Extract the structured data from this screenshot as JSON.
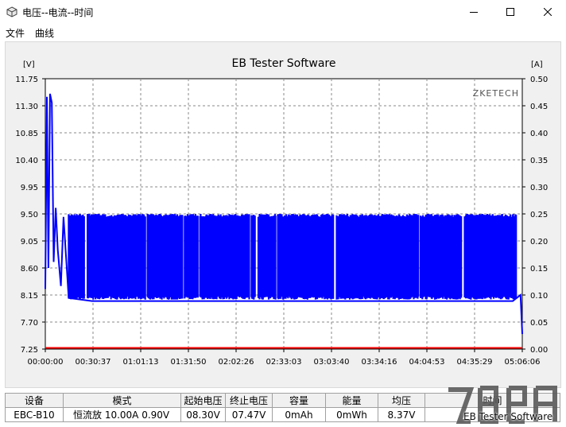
{
  "window": {
    "title": "电压--电流--时间"
  },
  "menu": [
    "文件",
    "曲线"
  ],
  "chart_data": {
    "type": "line",
    "title": "EB Tester Software",
    "brand": "ZKETECH",
    "left_unit": "[V]",
    "right_unit": "[A]",
    "x_ticks": [
      "00:00:00",
      "00:30:37",
      "01:01:13",
      "01:31:50",
      "02:02:26",
      "02:33:03",
      "03:03:40",
      "03:34:16",
      "04:04:53",
      "04:35:29",
      "05:06:06"
    ],
    "y_ticks_left": [
      "11.75",
      "11.30",
      "10.85",
      "10.40",
      "9.95",
      "9.50",
      "9.05",
      "8.60",
      "8.15",
      "7.70",
      "7.25"
    ],
    "y_ticks_right": [
      "0.50",
      "0.45",
      "0.40",
      "0.35",
      "0.30",
      "0.25",
      "0.20",
      "0.15",
      "0.10",
      "0.05",
      "0.00"
    ],
    "ylim_left": [
      7.25,
      11.75
    ],
    "ylim_right": [
      0.0,
      0.5
    ],
    "x_range_seconds": [
      0,
      18366
    ],
    "grid": true,
    "series": [
      {
        "axis": "left",
        "color": "#0000ff",
        "baseline": 8.1,
        "spike_high": 9.5,
        "points": [
          [
            0,
            8.25
          ],
          [
            60,
            11.45
          ],
          [
            120,
            8.6
          ],
          [
            180,
            11.5
          ],
          [
            250,
            11.35
          ],
          [
            320,
            8.7
          ],
          [
            400,
            9.6
          ],
          [
            480,
            8.9
          ],
          [
            600,
            8.3
          ],
          [
            700,
            9.45
          ],
          [
            900,
            8.1
          ],
          [
            1800,
            8.05
          ],
          [
            18000,
            8.05
          ],
          [
            18300,
            8.15
          ],
          [
            18366,
            7.5
          ]
        ]
      },
      {
        "axis": "right",
        "color": "#ff0000",
        "points": [
          [
            0,
            0.0
          ],
          [
            18366,
            0.0
          ]
        ]
      }
    ]
  },
  "status_table": {
    "headers": [
      "设备",
      "模式",
      "起始电压",
      "终止电压",
      "容量",
      "能量",
      "均压",
      "时间"
    ],
    "values": [
      "EBC-B10",
      "恒流放  10.00A  0.90V",
      "08.30V",
      "07.47V",
      "0mAh",
      "0mWh",
      "8.37V",
      ""
    ]
  },
  "watermark": {
    "caption": "EB Tester Software"
  }
}
